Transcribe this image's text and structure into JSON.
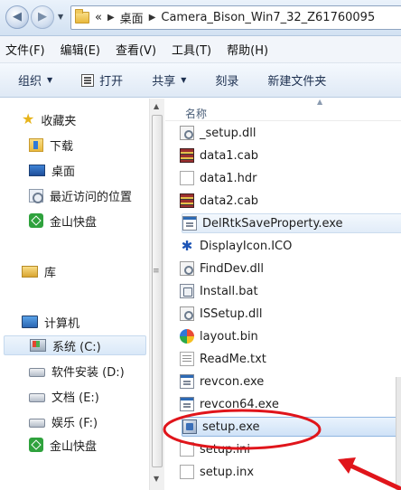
{
  "address_bar": {
    "overflow": "«",
    "crumbs": [
      "桌面",
      "Camera_Bison_Win7_32_Z61760095"
    ]
  },
  "menu": [
    "文件(F)",
    "编辑(E)",
    "查看(V)",
    "工具(T)",
    "帮助(H)"
  ],
  "toolbar": {
    "organize": "组织",
    "open": "打开",
    "share": "共享",
    "burn": "刻录",
    "new_folder": "新建文件夹"
  },
  "nav": {
    "favorites": {
      "label": "收藏夹",
      "items": [
        "下载",
        "桌面",
        "最近访问的位置",
        "金山快盘"
      ]
    },
    "libraries": "库",
    "computer": {
      "label": "计算机",
      "items": [
        "系统 (C:)",
        "软件安装 (D:)",
        "文档 (E:)",
        "娱乐 (F:)",
        "金山快盘"
      ]
    }
  },
  "file_list": {
    "column_name": "名称",
    "files": [
      {
        "name": "_setup.dll",
        "icon": "gear-icon"
      },
      {
        "name": "data1.cab",
        "icon": "cab-icon"
      },
      {
        "name": "data1.hdr",
        "icon": "document-icon"
      },
      {
        "name": "data2.cab",
        "icon": "cab-icon"
      },
      {
        "name": "DelRtkSaveProperty.exe",
        "icon": "exe-icon"
      },
      {
        "name": "DisplayIcon.ICO",
        "icon": "ico-file-icon"
      },
      {
        "name": "FindDev.dll",
        "icon": "gear-icon"
      },
      {
        "name": "Install.bat",
        "icon": "batch-icon"
      },
      {
        "name": "ISSetup.dll",
        "icon": "gear-icon"
      },
      {
        "name": "layout.bin",
        "icon": "bin-icon"
      },
      {
        "name": "ReadMe.txt",
        "icon": "text-icon"
      },
      {
        "name": "revcon.exe",
        "icon": "exe-icon"
      },
      {
        "name": "revcon64.exe",
        "icon": "exe-icon"
      },
      {
        "name": "setup.exe",
        "icon": "setup-icon"
      },
      {
        "name": "setup.ini",
        "icon": "document-icon"
      },
      {
        "name": "setup.inx",
        "icon": "document-icon"
      }
    ]
  },
  "colors": {
    "annotation": "#e0151b",
    "selection": "#cfe2f7"
  }
}
